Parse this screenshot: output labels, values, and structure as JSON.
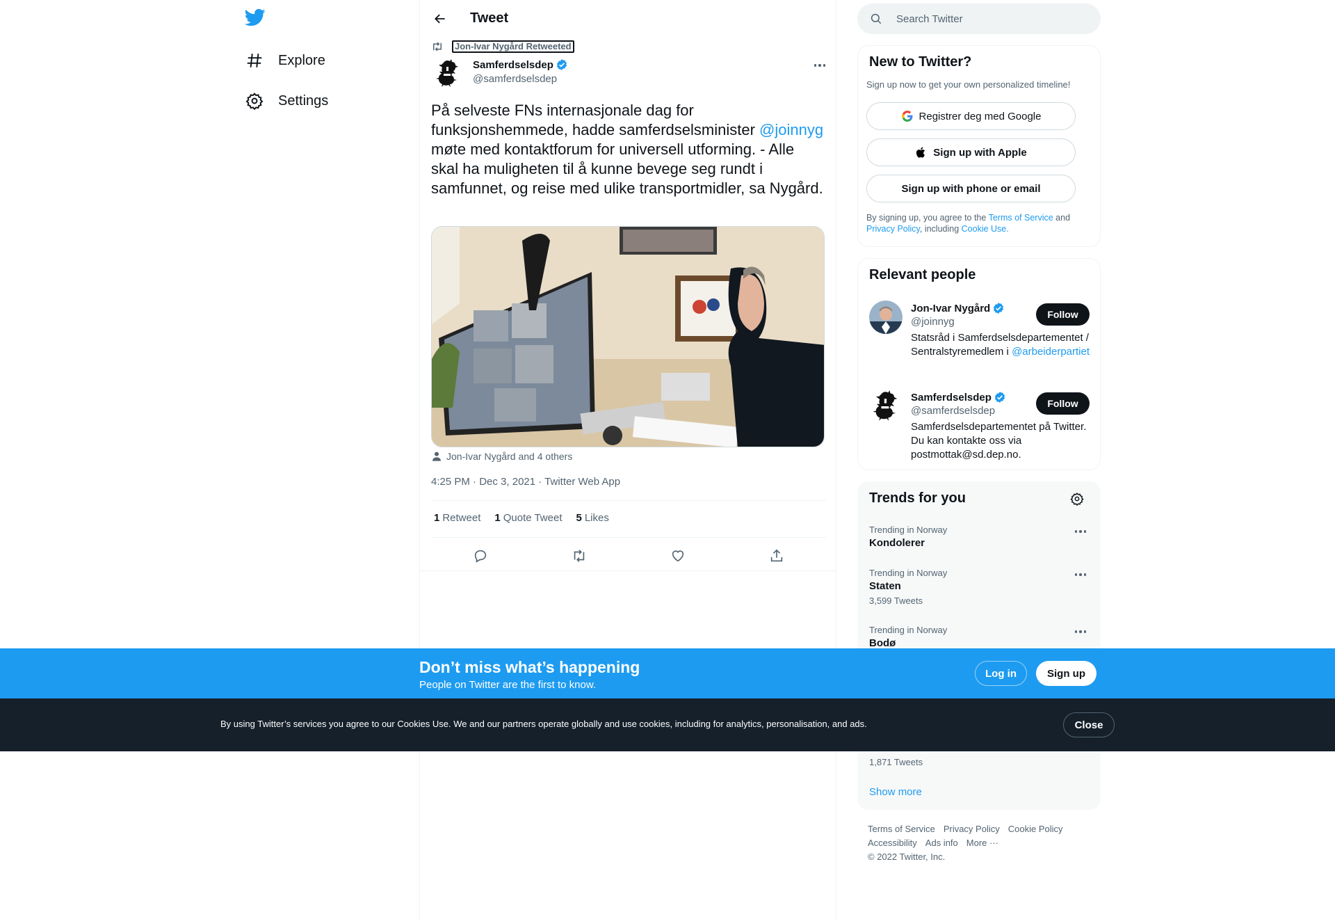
{
  "nav": {
    "logo": "twitter-bird-icon",
    "items": [
      {
        "label": "Explore",
        "icon": "hashtag-icon"
      },
      {
        "label": "Settings",
        "icon": "gear-icon"
      }
    ]
  },
  "header": {
    "title": "Tweet"
  },
  "tweet": {
    "retweeted_by": "Jon-Ivar Nygård Retweeted",
    "author_name": "Samferdselsdep",
    "author_handle": "@samferdselsdep",
    "text_before": "På selveste FNs internasjonale dag for funksjonshemmede, hadde samferdselsminister ",
    "mention": "@joinnyg",
    "text_after": " møte med kontaktforum for universell utforming. - Alle skal ha muligheten til å kunne bevege seg rundt i samfunnet, og reise med ulike transportmidler, sa Nygård.",
    "tagged": "Jon-Ivar Nygård and 4 others",
    "time": "4:25 PM",
    "date": "Dec 3, 2021",
    "source": "Twitter Web App",
    "sep": " · ",
    "stats": {
      "retweets": "1",
      "retweets_label": "Retweet",
      "quotes": "1",
      "quotes_label": "Quote Tweet",
      "likes": "5",
      "likes_label": "Likes"
    }
  },
  "search": {
    "placeholder": "Search Twitter"
  },
  "new_to_twitter": {
    "title": "New to Twitter?",
    "subtitle": "Sign up now to get your own personalized timeline!",
    "google": "Registrer deg med Google",
    "apple": "Sign up with Apple",
    "phone": "Sign up with phone or email",
    "legal_1": "By signing up, you agree to the ",
    "tos": "Terms of Service",
    "legal_2": " and ",
    "privacy": "Privacy Policy",
    "legal_3": ", including ",
    "cookie": "Cookie Use."
  },
  "relevant": {
    "title": "Relevant people",
    "people": [
      {
        "name": "Jon-Ivar Nygård",
        "handle": "@joinnyg",
        "bio": "Statsråd i Samferdselsdepartementet / Sentralstyremedlem i ",
        "bio_mention": "@arbeiderpartiet",
        "follow": "Follow"
      },
      {
        "name": "Samferdselsdep",
        "handle": "@samferdselsdep",
        "bio": "Samferdselsdepartementet på Twitter. Du kan kontakte oss via postmottak@sd.dep.no.",
        "follow": "Follow"
      }
    ]
  },
  "trends": {
    "title": "Trends for you",
    "items": [
      {
        "context": "Trending in Norway",
        "name": "Kondolerer",
        "count": ""
      },
      {
        "context": "Trending in Norway",
        "name": "Staten",
        "count": "3,599 Tweets"
      },
      {
        "context": "Trending in Norway",
        "name": "Bodø",
        "count": ""
      }
    ],
    "hidden_count": "1,871 Tweets",
    "show_more": "Show more"
  },
  "footer": {
    "links": [
      "Terms of Service",
      "Privacy Policy",
      "Cookie Policy",
      "Accessibility",
      "Ads info",
      "More ···"
    ],
    "copyright": "© 2022 Twitter, Inc."
  },
  "banner": {
    "title": "Don’t miss what’s happening",
    "subtitle": "People on Twitter are the first to know.",
    "login": "Log in",
    "signup": "Sign up"
  },
  "cookie_bar": {
    "text": "By using Twitter’s services you agree to our Cookies Use. We and our partners operate globally and use cookies, including for analytics, personalisation, and ads.",
    "close": "Close"
  },
  "colors": {
    "brand": "#1d9bf0",
    "text": "#0f1419",
    "muted": "#536471",
    "cookie_bg": "#15202b"
  }
}
